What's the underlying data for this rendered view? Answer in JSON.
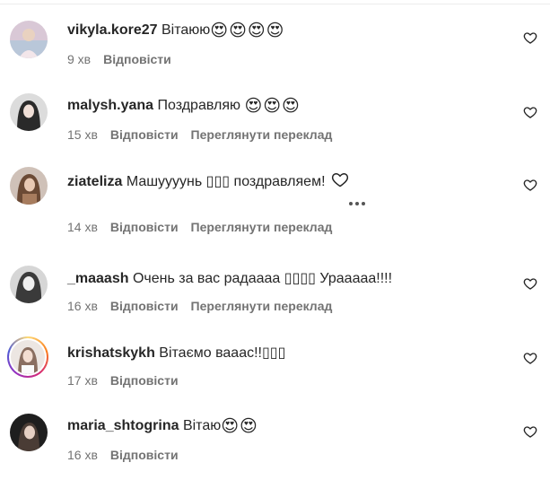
{
  "comments": [
    {
      "username": "vikyla.kore27",
      "text": "Вітаюю",
      "emoji": "😍😍😍😍",
      "time": "9 хв",
      "reply": "Відповісти",
      "translate": ""
    },
    {
      "username": "malysh.yana",
      "text": "Поздравляю ",
      "emoji": "😍😍😍",
      "time": "15 хв",
      "reply": "Відповісти",
      "translate": "Переглянути переклад"
    },
    {
      "username": "ziateliza",
      "text": "Машуууунь ▯▯▯ поздравляем!",
      "emoji": "",
      "time": "14 хв",
      "reply": "Відповісти",
      "translate": "Переглянути переклад"
    },
    {
      "username": "_maaash",
      "text": "Очень за вас радаааа ▯▯▯▯ Урааааа!!!!",
      "emoji": "",
      "time": "16 хв",
      "reply": "Відповісти",
      "translate": "Переглянути переклад"
    },
    {
      "username": "krishatskykh",
      "text": "Вітаємо вааас!!▯▯▯",
      "emoji": "",
      "time": "17 хв",
      "reply": "Відповісти",
      "translate": ""
    },
    {
      "username": "maria_shtogrina",
      "text": "Вітаю",
      "emoji": "😍😍",
      "time": "16 хв",
      "reply": "Відповісти",
      "translate": ""
    }
  ],
  "icons": {
    "like": "heart-outline-icon",
    "more": "more-options-icon"
  }
}
